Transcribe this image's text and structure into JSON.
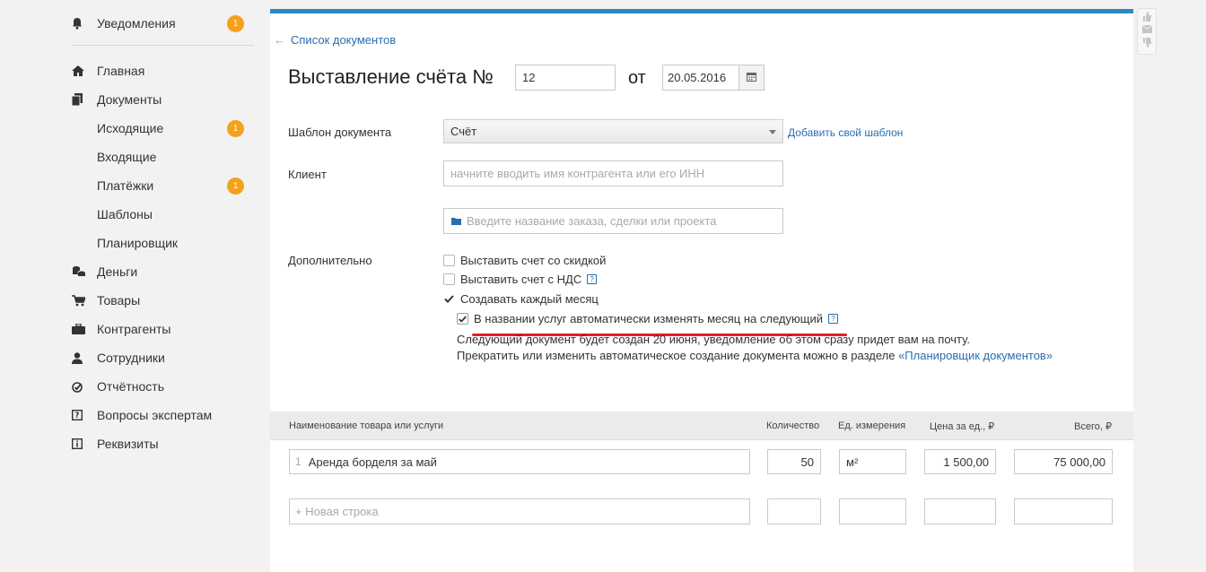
{
  "sidebar": {
    "notifications": {
      "label": "Уведомления",
      "badge": "1"
    },
    "items": [
      {
        "label": "Главная"
      },
      {
        "label": "Документы"
      },
      {
        "label": "Исходящие",
        "badge": "1"
      },
      {
        "label": "Входящие"
      },
      {
        "label": "Платёжки",
        "badge": "1"
      },
      {
        "label": "Шаблоны"
      },
      {
        "label": "Планировщик"
      },
      {
        "label": "Деньги"
      },
      {
        "label": "Товары"
      },
      {
        "label": "Контрагенты"
      },
      {
        "label": "Сотрудники"
      },
      {
        "label": "Отчётность"
      },
      {
        "label": "Вопросы экспертам"
      },
      {
        "label": "Реквизиты"
      }
    ]
  },
  "header": {
    "back_link": "Список документов",
    "back_arrow": "←",
    "title": "Выставление счёта №",
    "number": "12",
    "ot": "от",
    "date": "20.05.2016"
  },
  "form": {
    "template_label": "Шаблон документа",
    "template_value": "Счёт",
    "add_template": "Добавить свой шаблон",
    "client_label": "Клиент",
    "client_placeholder": "начните вводить имя контрагента или его ИНН",
    "order_placeholder": "Введите название заказа, сделки или проекта",
    "extra_label": "Дополнительно",
    "checkboxes": [
      {
        "label": "Выставить счет со скидкой",
        "checked": false
      },
      {
        "label": "Выставить счет с НДС",
        "checked": false
      },
      {
        "label": "Создавать каждый месяц",
        "checked": true
      },
      {
        "label": "В названии услуг автоматически изменять месяц на следующий",
        "checked": true
      }
    ],
    "help_glyph": "?",
    "note_line1": "Следующий документ будет создан 20 июня, уведомление об этом сразу придет вам на почту.",
    "note_line2": "Прекратить или изменить автоматическое создание документа можно в разделе ",
    "note_link": "«Планировщик документов»"
  },
  "table": {
    "headers": {
      "name": "Наименование товара или услуги",
      "qty": "Количество",
      "unit": "Ед. измерения",
      "price": "Цена за ед., ₽",
      "total": "Всего, ₽"
    },
    "rows": [
      {
        "idx": "1",
        "name": "Аренда борделя за май",
        "qty": "50",
        "unit": "м²",
        "price": "1 500,00",
        "total": "75 000,00"
      }
    ],
    "new_row": "+ Новая строка"
  },
  "colors": {
    "accent": "#2e88c2",
    "badge": "#f5a11e",
    "link": "#2a6db0",
    "highlight_underline": "#e31e24"
  }
}
